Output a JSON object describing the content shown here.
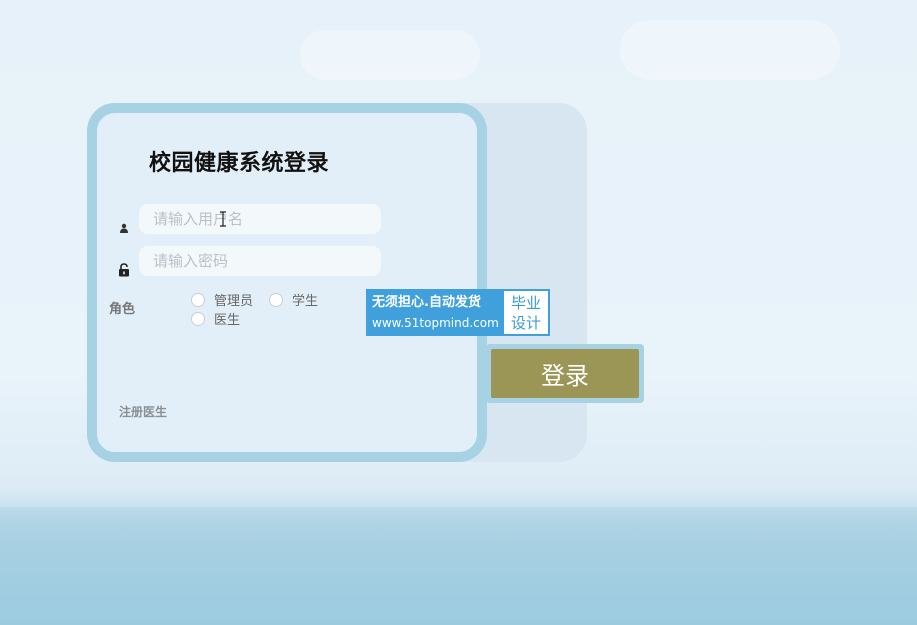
{
  "page": {
    "title": "校园健康系统登录"
  },
  "form": {
    "username_placeholder": "请输入用户名",
    "password_placeholder": "请输入密码",
    "role_label": "角色",
    "roles": [
      "管理员",
      "学生",
      "医生"
    ],
    "register_link": "注册医生",
    "submit_label": "登录"
  },
  "ad_banner": {
    "line1": "无须担心.自动发货",
    "line2": "www.51topmind.com",
    "badge_line1": "毕业",
    "badge_line2": "设计"
  },
  "icons": {
    "username": "user-icon",
    "password": "lock-icon"
  },
  "colors": {
    "card_border": "#a6d2e4",
    "submit_button": "#9b9556",
    "ad_blue": "#3fa0db"
  }
}
